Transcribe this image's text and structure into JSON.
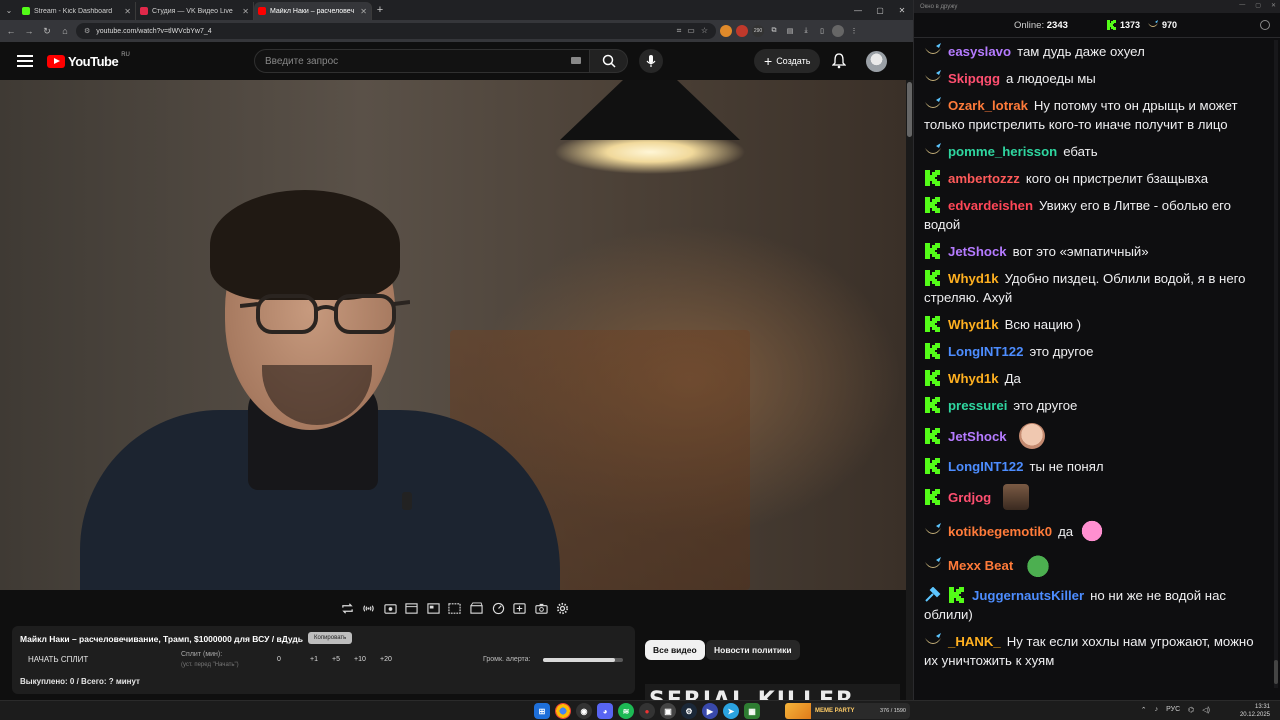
{
  "browser": {
    "tabs": [
      {
        "label": "Stream - Kick Dashboard",
        "favicon": "kick-icon",
        "color": "#53fc18",
        "active": false
      },
      {
        "label": "Студия — VK Видео Live",
        "favicon": "vk-icon",
        "color": "#e0294a",
        "active": false
      },
      {
        "label": "Майкл Наки – расчеловеч",
        "favicon": "youtube-icon",
        "color": "#ff0000",
        "active": true
      }
    ],
    "url": "youtube.com/watch?v=tlWVcbYw7_4",
    "extension_badge": "290"
  },
  "youtube": {
    "logo_text": "YouTube",
    "region": "RU",
    "search_placeholder": "Введите запрос",
    "create_label": "Создать"
  },
  "helper": {
    "title": "Майкл Наки – расчеловечивание, Трамп, $1000000 для ВСУ / вДудь",
    "copy_label": "Копировать",
    "split_button": "НАЧАТЬ СПЛИТ",
    "split_label": "Сплит (мин):",
    "split_hint": "(уст. перед \"Начать\")",
    "split_value": "0",
    "increments": [
      "+1",
      "+5",
      "+10",
      "+20"
    ],
    "alert_label": "Громк. алерта:",
    "alert_level": 0.9,
    "footer": "Выкуплено: 0 / Всего: ? минут"
  },
  "chips": {
    "all_videos": "Все видео",
    "politics_news": "Новости политики"
  },
  "next_video_peek": "SERIAL KILLER",
  "chat": {
    "window_title": "Окно в дружу",
    "online_label": "Online:",
    "online_count": "2343",
    "kick_count": "1373",
    "vk_count": "970",
    "colors": {
      "kick": "#53fc18",
      "vk_badge": "#c7b27a"
    },
    "messages": [
      {
        "platform": "vk",
        "user": "easyslavo",
        "color": "#b57bff",
        "text": "там дудь даже охуел",
        "emote": ""
      },
      {
        "platform": "vk",
        "user": "Skipqgg",
        "color": "#ff4f70",
        "text": "а людоеды мы",
        "emote": ""
      },
      {
        "platform": "vk",
        "user": "Ozark_lotrak",
        "color": "#ff7b3a",
        "text": "Ну потому что он дрыщь и может только пристрелить кого-то иначе получит в лицо",
        "emote": ""
      },
      {
        "platform": "vk",
        "user": "pomme_herisson",
        "color": "#2fd6a0",
        "text": "ебать",
        "emote": ""
      },
      {
        "platform": "kick",
        "user": "ambertozzz",
        "color": "#ff5a5a",
        "text": "кого он пристрелит бзащывха",
        "emote": ""
      },
      {
        "platform": "kick",
        "user": "edvardeishen",
        "color": "#ff4757",
        "text": "Увижу его в Литве - оболью его водой",
        "emote": ""
      },
      {
        "platform": "kick",
        "user": "JetShock",
        "color": "#b57bff",
        "text": "вот это «эмпатичный»",
        "emote": ""
      },
      {
        "platform": "kick",
        "user": "Whyd1k",
        "color": "#ffb020",
        "text": "Удобно пиздец. Облили водой, я в него стреляю. Ахуй",
        "emote": ""
      },
      {
        "platform": "kick",
        "user": "Whyd1k",
        "color": "#ffb020",
        "text": "Всю нацию )",
        "emote": ""
      },
      {
        "platform": "kick",
        "user": "LongINT122",
        "color": "#4d8dff",
        "text": "это другое",
        "emote": ""
      },
      {
        "platform": "kick",
        "user": "Whyd1k",
        "color": "#ffb020",
        "text": "Да",
        "emote": ""
      },
      {
        "platform": "kick",
        "user": "pressurei",
        "color": "#2fd6a0",
        "text": "это другое",
        "emote": ""
      },
      {
        "platform": "kick",
        "user": "JetShock",
        "color": "#b57bff",
        "text": "",
        "emote": "bald-head-emote"
      },
      {
        "platform": "kick",
        "user": "LongINT122",
        "color": "#4d8dff",
        "text": "ты не понял",
        "emote": ""
      },
      {
        "platform": "kick",
        "user": "Grdjog",
        "color": "#ff4f70",
        "text": "",
        "emote": "face-photo-emote"
      },
      {
        "platform": "vk",
        "user": "kotikbegemotik0",
        "color": "#ff7b3a",
        "text": "да",
        "emote": "pink-cat-emote"
      },
      {
        "platform": "vk",
        "user": "Mexx Beat",
        "color": "#ff7b3a",
        "text": "",
        "emote": "pepe-frog-emote"
      },
      {
        "platform": "kick-tool",
        "user": "JuggernautsKiller",
        "color": "#4d8dff",
        "text": "но ни же не водой нас облили)",
        "emote": ""
      },
      {
        "platform": "vk",
        "user": "_HANK_",
        "color": "#ffb020",
        "text": "Ну так если хохлы нам угрожают, можно их уничтожить к хуям",
        "emote": ""
      }
    ]
  },
  "taskbar": {
    "media_title": "MEME PARTY",
    "media_counter": "376 / 1590",
    "lang": "РУС",
    "time": "13:31",
    "date": "20.12.2025"
  }
}
